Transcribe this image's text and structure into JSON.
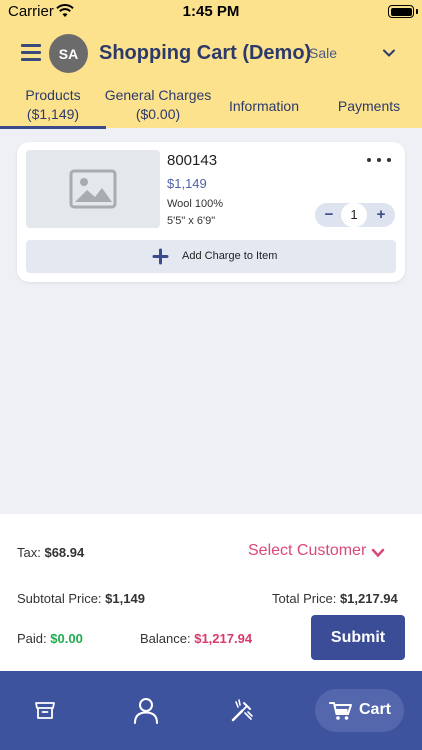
{
  "status_bar": {
    "carrier": "Carrier",
    "time": "1:45 PM"
  },
  "header": {
    "avatar_initials": "SA",
    "title": "Shopping Cart (Demo)",
    "mode": "Sale"
  },
  "tabs": [
    {
      "label": "Products",
      "sub": "($1,149)",
      "active": true
    },
    {
      "label": "General Charges",
      "sub": "($0.00)",
      "active": false
    },
    {
      "label": "Information",
      "active": false
    },
    {
      "label": "Payments",
      "active": false
    }
  ],
  "cart_item": {
    "name": "800143",
    "price": "$1,149",
    "material": "Wool 100%",
    "size": "5'5\" x 6'9\"",
    "quantity": "1",
    "minus": "−",
    "plus": "+",
    "add_charge_label": "Add Charge to Item"
  },
  "summary": {
    "tax_label": "Tax:",
    "tax_value": "$68.94",
    "select_customer": "Select Customer",
    "subtotal_label": "Subtotal Price:",
    "subtotal_value": "$1,149",
    "total_label": "Total Price:",
    "total_value": "$1,217.94",
    "paid_label": "Paid:",
    "paid_value": "$0.00",
    "balance_label": "Balance:",
    "balance_value": "$1,217.94",
    "submit_label": "Submit"
  },
  "bottom_nav": {
    "cart_label": "Cart"
  },
  "colors": {
    "header_bg": "#fde28d",
    "nav_bg": "#3d539e",
    "primary": "#3a4d96",
    "accent_pink": "#d9497a",
    "paid_green": "#1fae4d"
  }
}
